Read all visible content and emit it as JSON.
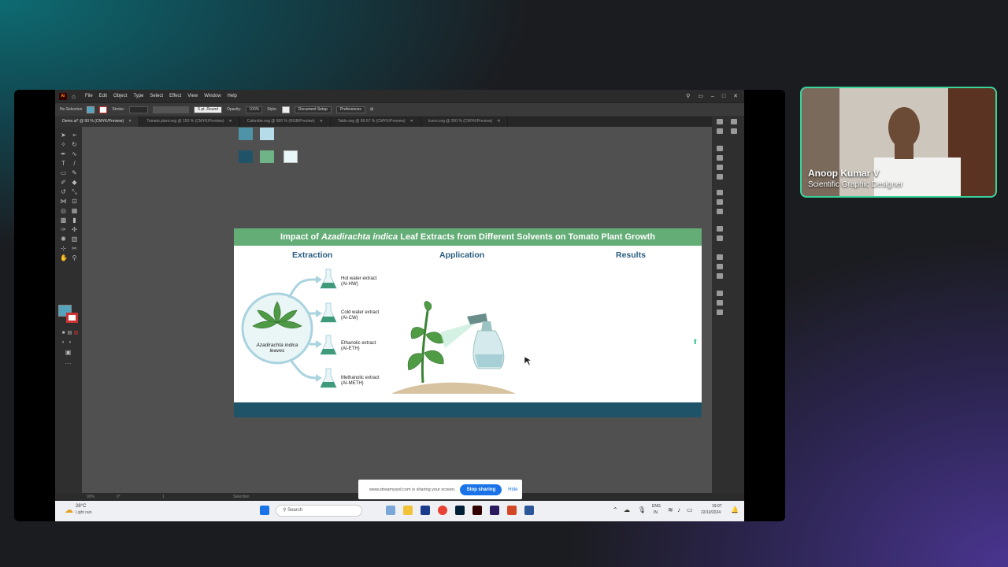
{
  "app": {
    "logo": "Ai",
    "menu": [
      "File",
      "Edit",
      "Object",
      "Type",
      "Select",
      "Effect",
      "View",
      "Window",
      "Help"
    ],
    "control_bar": {
      "selection": "No Selection",
      "stroke_label": "Stroke:",
      "brush": "5 pt. Round",
      "opacity_label": "Opacity:",
      "opacity_value": "100%",
      "style_label": "Style:",
      "document_setup": "Document Setup",
      "preferences": "Preferences"
    },
    "tabs": [
      {
        "label": "Demo.ai* @ 90 % (CMYK/Preview)",
        "active": true
      },
      {
        "label": "Tomato plant.svg @ 150 % (CMYK/Preview)"
      },
      {
        "label": "Calendar.svg @ 900 % (RGB/Preview)"
      },
      {
        "label": "Table.svg @ 66.67 % (CMYK/Preview)"
      },
      {
        "label": "Icons.svg @ 200 % (CMYK/Preview)"
      }
    ],
    "icons": {
      "home": "home-icon",
      "search": "search-icon",
      "window_controls": [
        "minimize-icon",
        "maximize-icon",
        "close-icon"
      ]
    },
    "swatch_colors": [
      "#4e93a8",
      "#b6dcea",
      "#1f5468",
      "#6fb487",
      "#eaf7f8"
    ],
    "fill_color": "#55a4bd",
    "status": {
      "zoom": "90%",
      "rotate": "0°",
      "page": "1",
      "tool": "Selection"
    }
  },
  "artboard": {
    "title_prefix": "Impact of ",
    "title_italic": "Azadirachta indica",
    "title_suffix": " Leaf Extracts from Different Solvents on Tomato Plant Growth",
    "sections": [
      "Extraction",
      "Application",
      "Results"
    ],
    "source_label": "Azadirachta indica leaves",
    "extracts": [
      {
        "name": "Hot water extract",
        "code": "(AI-HW)"
      },
      {
        "name": "Cold water extract",
        "code": "(AI-CW)"
      },
      {
        "name": "Ethanolic extract",
        "code": "(AI-ETH)"
      },
      {
        "name": "Methanolic extract",
        "code": "(AI-METH)"
      }
    ],
    "colors": {
      "header": "#64ad76",
      "footer": "#1f5468",
      "heading_text": "#2a5d80"
    }
  },
  "share_banner": {
    "message": "www.streamyard.com is sharing your screen.",
    "stop": "Stop sharing",
    "hide": "Hide"
  },
  "taskbar": {
    "weather_temp": "28°C",
    "weather_desc": "Light rain",
    "search_placeholder": "Search",
    "lang": "ENG",
    "region": "IN",
    "time": "19:07",
    "date": "22/10/2024"
  },
  "participant": {
    "name": "Anoop Kumar V",
    "role": "Scientific Graphic Designer",
    "border_color": "#38d39a"
  }
}
